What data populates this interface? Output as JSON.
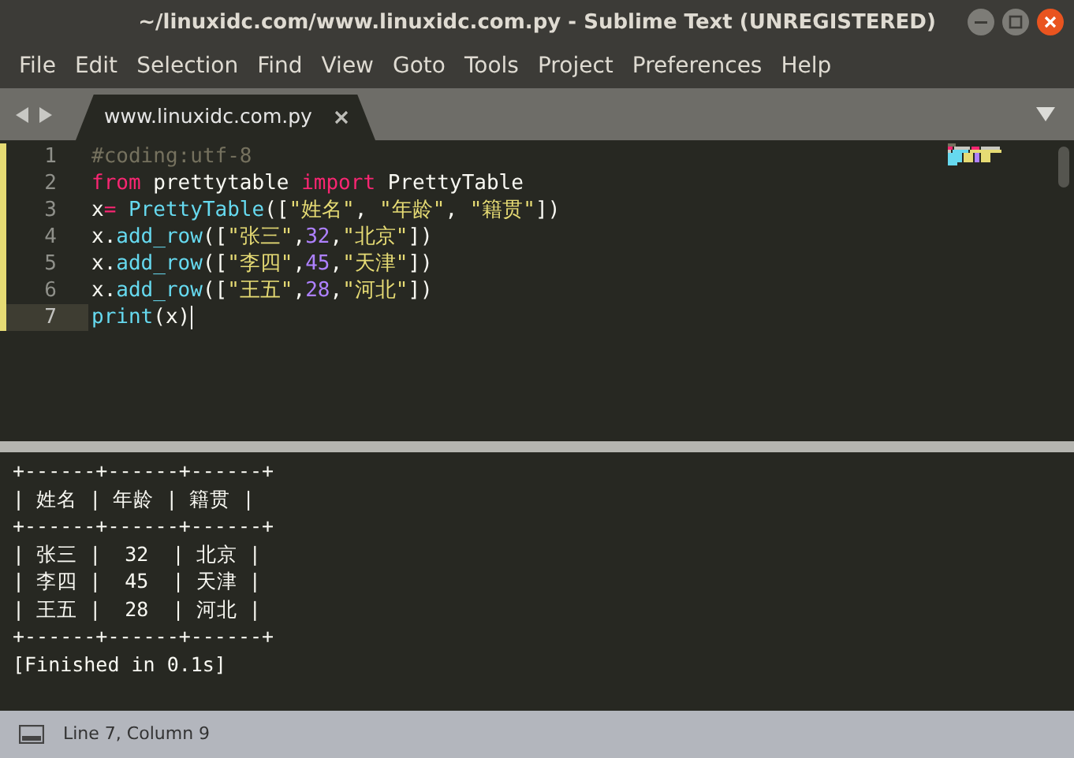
{
  "window": {
    "title": "~/linuxidc.com/www.linuxidc.com.py - Sublime Text (UNREGISTERED)"
  },
  "menu": [
    "File",
    "Edit",
    "Selection",
    "Find",
    "View",
    "Goto",
    "Tools",
    "Project",
    "Preferences",
    "Help"
  ],
  "tabs": [
    {
      "label": "www.linuxidc.com.py",
      "selected": true
    }
  ],
  "editor": {
    "lines": [
      {
        "number": "1",
        "modified": true,
        "current": false,
        "tokens": [
          {
            "kind": "comment",
            "text": "#coding:utf-8"
          }
        ]
      },
      {
        "number": "2",
        "modified": true,
        "current": false,
        "tokens": [
          {
            "kind": "keyword",
            "text": "from"
          },
          {
            "kind": "plain",
            "text": " prettytable "
          },
          {
            "kind": "keyword",
            "text": "import"
          },
          {
            "kind": "plain",
            "text": " PrettyTable"
          }
        ]
      },
      {
        "number": "3",
        "modified": true,
        "current": false,
        "tokens": [
          {
            "kind": "plain",
            "text": "x"
          },
          {
            "kind": "keyword",
            "text": "="
          },
          {
            "kind": "call",
            "text": " PrettyTable"
          },
          {
            "kind": "plain",
            "text": "(["
          },
          {
            "kind": "string",
            "text": "\"姓名\""
          },
          {
            "kind": "plain",
            "text": ", "
          },
          {
            "kind": "string",
            "text": "\"年龄\""
          },
          {
            "kind": "plain",
            "text": ", "
          },
          {
            "kind": "string",
            "text": "\"籍贯\""
          },
          {
            "kind": "plain",
            "text": "])"
          }
        ]
      },
      {
        "number": "4",
        "modified": true,
        "current": false,
        "tokens": [
          {
            "kind": "plain",
            "text": "x."
          },
          {
            "kind": "call",
            "text": "add_row"
          },
          {
            "kind": "plain",
            "text": "(["
          },
          {
            "kind": "string",
            "text": "\"张三\""
          },
          {
            "kind": "plain",
            "text": ","
          },
          {
            "kind": "number",
            "text": "32"
          },
          {
            "kind": "plain",
            "text": ","
          },
          {
            "kind": "string",
            "text": "\"北京\""
          },
          {
            "kind": "plain",
            "text": "])"
          }
        ]
      },
      {
        "number": "5",
        "modified": true,
        "current": false,
        "tokens": [
          {
            "kind": "plain",
            "text": "x."
          },
          {
            "kind": "call",
            "text": "add_row"
          },
          {
            "kind": "plain",
            "text": "(["
          },
          {
            "kind": "string",
            "text": "\"李四\""
          },
          {
            "kind": "plain",
            "text": ","
          },
          {
            "kind": "number",
            "text": "45"
          },
          {
            "kind": "plain",
            "text": ","
          },
          {
            "kind": "string",
            "text": "\"天津\""
          },
          {
            "kind": "plain",
            "text": "])"
          }
        ]
      },
      {
        "number": "6",
        "modified": true,
        "current": false,
        "tokens": [
          {
            "kind": "plain",
            "text": "x."
          },
          {
            "kind": "call",
            "text": "add_row"
          },
          {
            "kind": "plain",
            "text": "(["
          },
          {
            "kind": "string",
            "text": "\"王五\""
          },
          {
            "kind": "plain",
            "text": ","
          },
          {
            "kind": "number",
            "text": "28"
          },
          {
            "kind": "plain",
            "text": ","
          },
          {
            "kind": "string",
            "text": "\"河北\""
          },
          {
            "kind": "plain",
            "text": "])"
          }
        ]
      },
      {
        "number": "7",
        "modified": true,
        "current": true,
        "tokens": [
          {
            "kind": "call",
            "text": "print"
          },
          {
            "kind": "plain",
            "text": "(x)"
          }
        ]
      }
    ]
  },
  "output": {
    "lines": [
      "+------+------+------+",
      "| 姓名 | 年龄 | 籍贯 |",
      "+------+------+------+",
      "| 张三 |  32  | 北京 |",
      "| 李四 |  45  | 天津 |",
      "| 王五 |  28  | 河北 |",
      "+------+------+------+",
      "[Finished in 0.1s]"
    ]
  },
  "status_bar": {
    "position": "Line 7, Column 9"
  }
}
